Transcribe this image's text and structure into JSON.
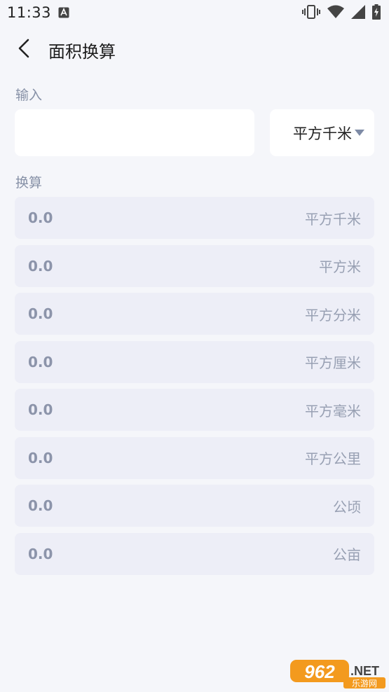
{
  "status_bar": {
    "time": "11:33"
  },
  "header": {
    "title": "面积换算"
  },
  "input_section": {
    "label": "输入",
    "value": "",
    "selected_unit": "平方千米"
  },
  "conversion_section": {
    "label": "换算",
    "rows": [
      {
        "value": "0.0",
        "unit": "平方千米"
      },
      {
        "value": "0.0",
        "unit": "平方米"
      },
      {
        "value": "0.0",
        "unit": "平方分米"
      },
      {
        "value": "0.0",
        "unit": "平方厘米"
      },
      {
        "value": "0.0",
        "unit": "平方毫米"
      },
      {
        "value": "0.0",
        "unit": "平方公里"
      },
      {
        "value": "0.0",
        "unit": "公顷"
      },
      {
        "value": "0.0",
        "unit": "公亩"
      }
    ]
  },
  "watermark": {
    "brand": "962",
    "suffix": ".NET",
    "caption": "乐游网"
  },
  "colors": {
    "background": "#F5F6FA",
    "card": "#FFFFFF",
    "row_background": "#EDEEF7",
    "muted_text": "#8C94AA",
    "label_text": "#8791A7",
    "dropdown_arrow": "#7E8BA6",
    "watermark_orange": "#F39A1E"
  },
  "icons": {
    "back": "chevron-left-icon",
    "dropdown": "triangle-down-icon",
    "notification": "app-notification-icon",
    "vibrate": "vibrate-icon",
    "wifi": "wifi-icon",
    "signal": "signal-icon",
    "battery": "battery-charging-icon"
  }
}
